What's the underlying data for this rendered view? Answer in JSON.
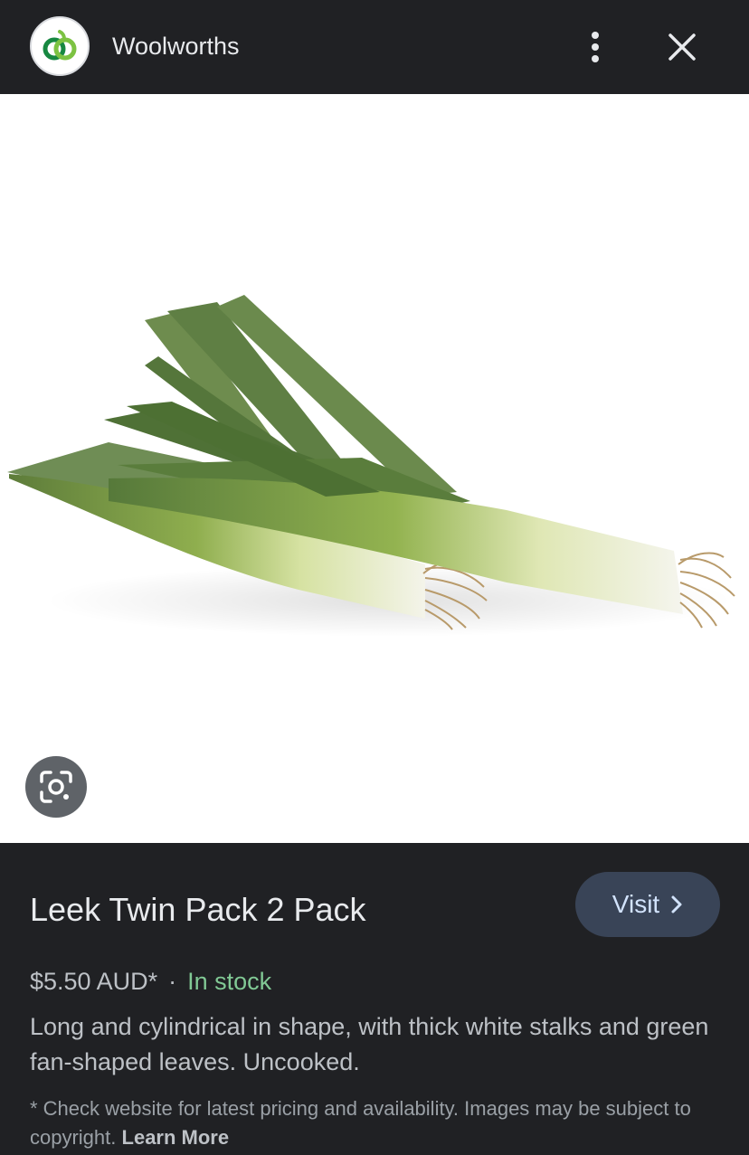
{
  "header": {
    "site_name": "Woolworths",
    "logo_icon": "woolworths-logo-icon",
    "more_icon": "more-vert-icon",
    "close_icon": "close-icon"
  },
  "image": {
    "subject": "leek-product-image",
    "lens_icon": "google-lens-icon"
  },
  "product": {
    "title": "Leek Twin Pack 2 Pack",
    "visit_label": "Visit",
    "visit_icon": "chevron-right-icon",
    "price": "$5.50 AUD*",
    "separator": "·",
    "stock_status": "In stock",
    "description": "Long and cylindrical in shape, with thick white stalks and green fan-shaped leaves. Uncooked.",
    "disclaimer": "* Check website for latest pricing and availability. Images may be subject to copyright.",
    "learn_more": "Learn More"
  },
  "colors": {
    "background": "#202124",
    "stock_green": "#81c995",
    "visit_button": "#394457",
    "visit_text": "#d2e3fc",
    "brand_green": "#4caf50"
  }
}
